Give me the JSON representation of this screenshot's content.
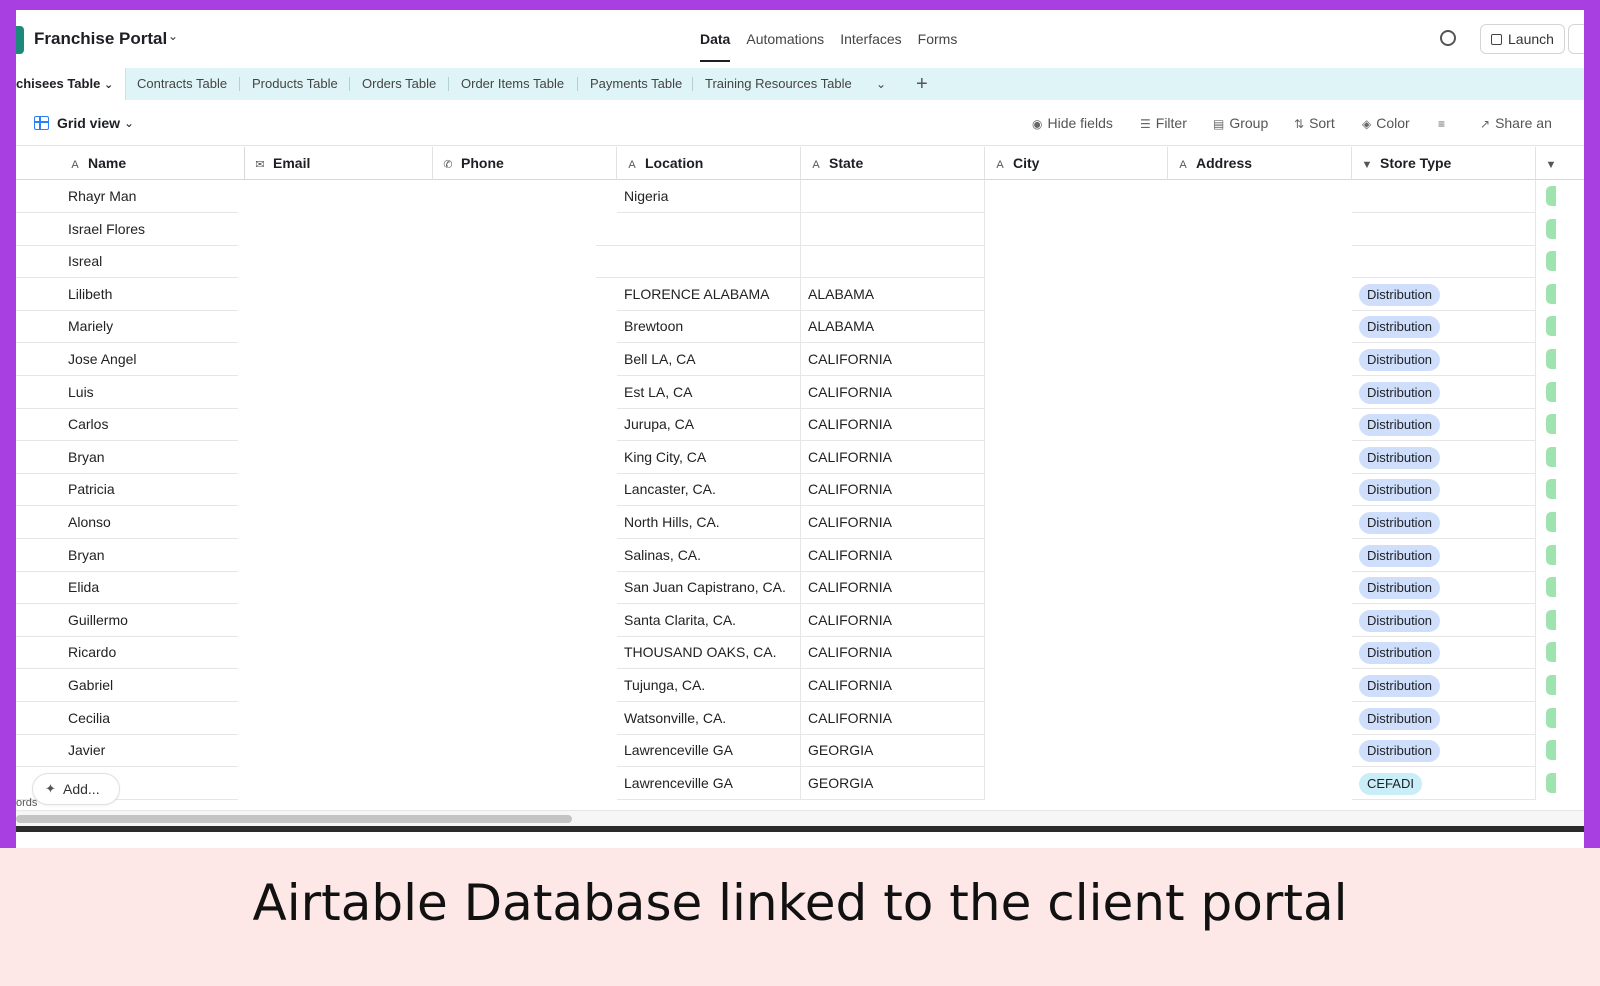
{
  "header": {
    "base_name": "Franchise Portal",
    "nav_tabs": [
      "Data",
      "Automations",
      "Interfaces",
      "Forms"
    ],
    "launch_label": "Launch"
  },
  "table_tabs": [
    "chisees Table",
    "Contracts Table",
    "Products Table",
    "Orders Table",
    "Order Items Table",
    "Payments Table",
    "Training Resources Table"
  ],
  "view": {
    "name": "Grid view",
    "tools": [
      "Hide fields",
      "Filter",
      "Group",
      "Sort",
      "Color",
      "Share an"
    ]
  },
  "columns": [
    "Name",
    "Email",
    "Phone",
    "Location",
    "State",
    "City",
    "Address",
    "Store Type"
  ],
  "rows": [
    {
      "name": "Rhayr Man",
      "location": "Nigeria",
      "state": "",
      "store_type": ""
    },
    {
      "name": "Israel Flores",
      "location": "",
      "state": "",
      "store_type": ""
    },
    {
      "name": "Isreal",
      "location": "",
      "state": "",
      "store_type": ""
    },
    {
      "name": "Lilibeth",
      "location": "FLORENCE ALABAMA",
      "state": "ALABAMA",
      "store_type": "Distribution"
    },
    {
      "name": "Mariely",
      "location": "Brewtoon",
      "state": "ALABAMA",
      "store_type": "Distribution"
    },
    {
      "name": "Jose Angel",
      "location": "Bell LA, CA",
      "state": "CALIFORNIA",
      "store_type": "Distribution"
    },
    {
      "name": "Luis",
      "location": "Est LA, CA",
      "state": "CALIFORNIA",
      "store_type": "Distribution"
    },
    {
      "name": "Carlos",
      "location": "Jurupa, CA",
      "state": "CALIFORNIA",
      "store_type": "Distribution"
    },
    {
      "name": "Bryan",
      "location": "King City, CA",
      "state": "CALIFORNIA",
      "store_type": "Distribution"
    },
    {
      "name": "Patricia",
      "location": "Lancaster, CA.",
      "state": "CALIFORNIA",
      "store_type": "Distribution"
    },
    {
      "name": "Alonso",
      "location": "North Hills, CA.",
      "state": "CALIFORNIA",
      "store_type": "Distribution"
    },
    {
      "name": "Bryan",
      "location": "Salinas, CA.",
      "state": "CALIFORNIA",
      "store_type": "Distribution"
    },
    {
      "name": "Elida",
      "location": "San Juan Capistrano, CA.",
      "state": "CALIFORNIA",
      "store_type": "Distribution"
    },
    {
      "name": "Guillermo",
      "location": "Santa Clarita, CA.",
      "state": "CALIFORNIA",
      "store_type": "Distribution"
    },
    {
      "name": "Ricardo",
      "location": "THOUSAND OAKS, CA.",
      "state": "CALIFORNIA",
      "store_type": "Distribution"
    },
    {
      "name": "Gabriel",
      "location": "Tujunga, CA.",
      "state": "CALIFORNIA",
      "store_type": "Distribution"
    },
    {
      "name": "Cecilia",
      "location": "Watsonville, CA.",
      "state": "CALIFORNIA",
      "store_type": "Distribution"
    },
    {
      "name": "Javier",
      "location": "Lawrenceville GA",
      "state": "GEORGIA",
      "store_type": "Distribution"
    },
    {
      "name": "",
      "location": "Lawrenceville GA",
      "state": "GEORGIA",
      "store_type": "CEFADI"
    }
  ],
  "pill_colors": {
    "Distribution": "#cfdffb",
    "CEFADI": "#c9eef8"
  },
  "add_label": "Add...",
  "records_label": "ords",
  "caption": "Airtable Database linked to the client portal",
  "colors": {
    "frame": "#a83fe0",
    "caption_bg": "#fde7e7",
    "tab_bar": "#dff4f6",
    "accent": "#2d7ff9"
  }
}
